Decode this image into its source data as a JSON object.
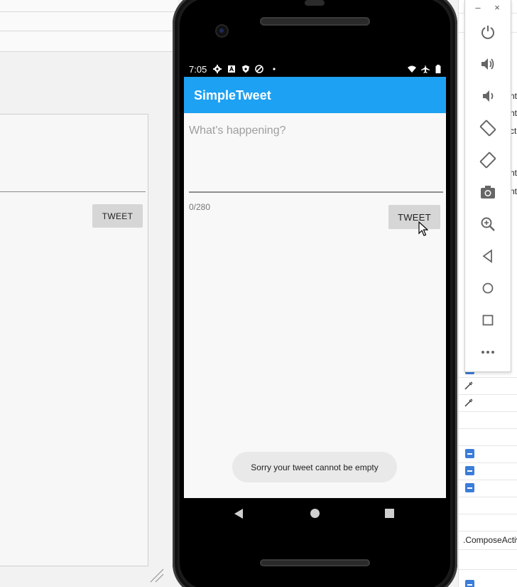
{
  "app": {
    "title": "SimpleTweet",
    "status_time": "7:05"
  },
  "compose": {
    "placeholder": "What's happening?",
    "counter": "0/280",
    "tweet_button": "TWEET"
  },
  "toast": {
    "message": "Sorry your tweet cannot be empty"
  },
  "preview": {
    "tweet_button": "TWEET"
  },
  "properties_panel": {
    "truncated_labels": [
      "nt",
      "nt",
      "cti",
      "nt",
      "nt"
    ],
    "compose_activity": ".ComposeActiv"
  },
  "emulator_toolbar": {
    "window_controls": [
      "minimize-icon",
      "close-icon"
    ],
    "minimize_glyph": "–",
    "close_glyph": "×",
    "buttons": [
      "power-icon",
      "volume-up-icon",
      "volume-down-icon",
      "rotate-left-icon",
      "rotate-right-icon",
      "camera-icon",
      "zoom-icon",
      "back-icon",
      "home-icon",
      "overview-icon",
      "more-icon"
    ]
  },
  "colors": {
    "appbar": "#1da1f2",
    "screen_bg": "#f8f8f8",
    "button_bg": "#d6d6d6",
    "toast_bg": "#e9e9e9",
    "accent_blue": "#3b7dd8"
  }
}
